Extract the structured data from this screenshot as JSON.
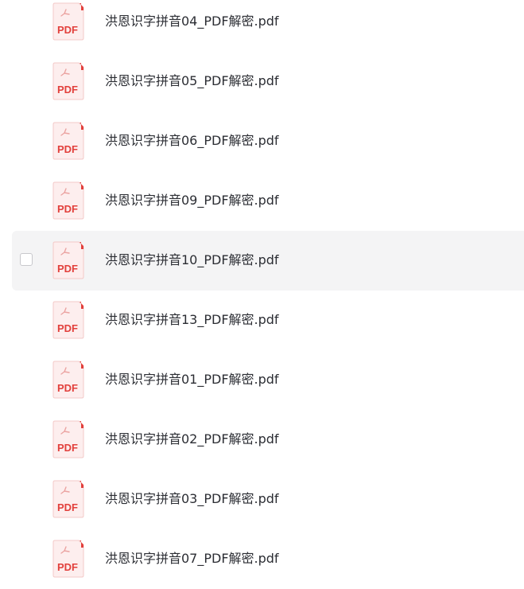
{
  "files": [
    {
      "name": "洪恩识字拼音04_PDF解密.pdf",
      "icon": "pdf-file-icon",
      "icon_label": "PDF"
    },
    {
      "name": "洪恩识字拼音05_PDF解密.pdf",
      "icon": "pdf-file-icon",
      "icon_label": "PDF"
    },
    {
      "name": "洪恩识字拼音06_PDF解密.pdf",
      "icon": "pdf-file-icon",
      "icon_label": "PDF"
    },
    {
      "name": "洪恩识字拼音09_PDF解密.pdf",
      "icon": "pdf-file-icon",
      "icon_label": "PDF"
    },
    {
      "name": "洪恩识字拼音10_PDF解密.pdf",
      "icon": "pdf-file-icon",
      "icon_label": "PDF",
      "hovered": true,
      "checked": false
    },
    {
      "name": "洪恩识字拼音13_PDF解密.pdf",
      "icon": "pdf-file-icon",
      "icon_label": "PDF"
    },
    {
      "name": "洪恩识字拼音01_PDF解密.pdf",
      "icon": "pdf-file-icon",
      "icon_label": "PDF"
    },
    {
      "name": "洪恩识字拼音02_PDF解密.pdf",
      "icon": "pdf-file-icon",
      "icon_label": "PDF"
    },
    {
      "name": "洪恩识字拼音03_PDF解密.pdf",
      "icon": "pdf-file-icon",
      "icon_label": "PDF"
    },
    {
      "name": "洪恩识字拼音07_PDF解密.pdf",
      "icon": "pdf-file-icon",
      "icon_label": "PDF"
    }
  ],
  "colors": {
    "pdf_red": "#e2403c",
    "icon_bg": "#fdeeee",
    "hover_bg": "#f4f4f5",
    "text": "#2b2d33"
  }
}
